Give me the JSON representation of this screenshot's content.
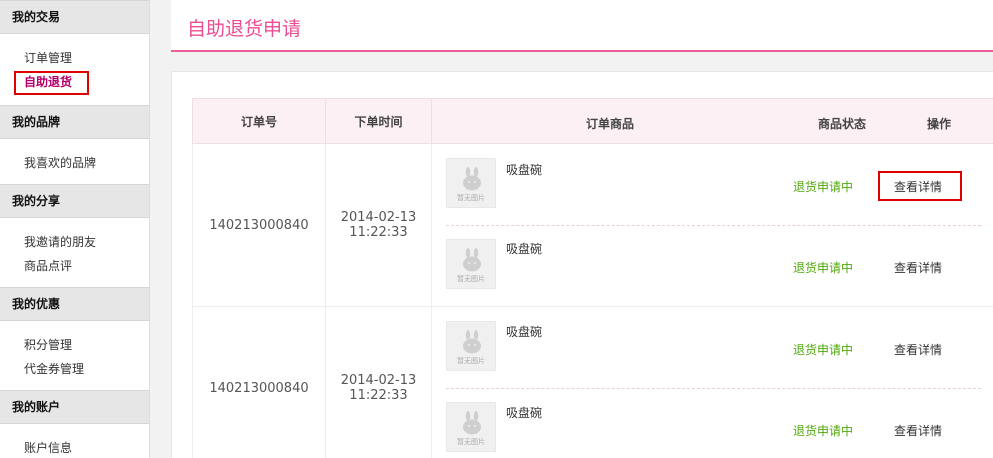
{
  "sidebar": {
    "sections": [
      {
        "title": "我的交易",
        "items": [
          "订单管理",
          "自助退货"
        ]
      },
      {
        "title": "我的品牌",
        "items": [
          "我喜欢的品牌"
        ]
      },
      {
        "title": "我的分享",
        "items": [
          "我邀请的朋友",
          "商品点评"
        ]
      },
      {
        "title": "我的优惠",
        "items": [
          "积分管理",
          "代金券管理"
        ]
      },
      {
        "title": "我的账户",
        "items": [
          "账户信息"
        ]
      }
    ],
    "active_item": "自助退货"
  },
  "page_title": "自助退货申请",
  "table": {
    "headers": [
      "订单号",
      "下单时间",
      "订单商品",
      "商品状态",
      "操作"
    ],
    "orders": [
      {
        "order_no": "140213000840",
        "date": "2014-02-13",
        "time": "11:22:33",
        "goods": [
          {
            "thumb_text": "暂无图片",
            "name": "吸盘碗",
            "status": "退货申请中",
            "action": "查看详情"
          },
          {
            "thumb_text": "暂无图片",
            "name": "吸盘碗",
            "status": "退货申请中",
            "action": "查看详情"
          }
        ]
      },
      {
        "order_no": "140213000840",
        "date": "2014-02-13",
        "time": "11:22:33",
        "goods": [
          {
            "thumb_text": "暂无图片",
            "name": "吸盘碗",
            "status": "退货申请中",
            "action": "查看详情"
          },
          {
            "thumb_text": "暂无图片",
            "name": "吸盘碗",
            "status": "退货申请中",
            "action": "查看详情"
          }
        ]
      }
    ]
  },
  "colors": {
    "accent_pink": "#ec4d92",
    "status_green": "#50a80a",
    "highlight_red": "#e00000"
  }
}
